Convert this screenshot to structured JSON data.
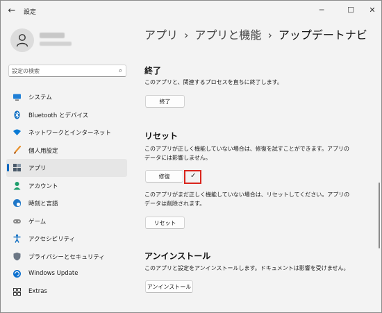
{
  "window": {
    "title": "設定",
    "back_icon": "arrow-left-icon",
    "controls": {
      "minimize": "─",
      "maximize": "☐",
      "close": "✕"
    }
  },
  "profile": {
    "avatar_icon": "person-icon"
  },
  "search": {
    "placeholder": "設定の検索",
    "icon": "search-icon"
  },
  "sidebar": {
    "items": [
      {
        "label": "システム",
        "icon": "monitor-icon",
        "color": "#0067c0"
      },
      {
        "label": "Bluetooth とデバイス",
        "icon": "bluetooth-icon",
        "color": "#0067c0"
      },
      {
        "label": "ネットワークとインターネット",
        "icon": "wifi-icon",
        "color": "#0a7ad4"
      },
      {
        "label": "個人用設定",
        "icon": "brush-icon",
        "color": "#e8912d"
      },
      {
        "label": "アプリ",
        "icon": "apps-icon",
        "color": "#4a5a6a",
        "active": true
      },
      {
        "label": "アカウント",
        "icon": "account-icon",
        "color": "#1e9e6c"
      },
      {
        "label": "時刻と言語",
        "icon": "globe-clock-icon",
        "color": "#1f77c8"
      },
      {
        "label": "ゲーム",
        "icon": "gamepad-icon",
        "color": "#7a7a7a"
      },
      {
        "label": "アクセシビリティ",
        "icon": "accessibility-icon",
        "color": "#1a74c4"
      },
      {
        "label": "プライバシーとセキュリティ",
        "icon": "shield-icon",
        "color": "#6c7785"
      },
      {
        "label": "Windows Update",
        "icon": "update-icon",
        "color": "#0a6fcf"
      },
      {
        "label": "Extras",
        "icon": "extras-icon",
        "color": "#333333"
      }
    ]
  },
  "breadcrumb": {
    "part1": "アプリ",
    "part2": "アプリと機能",
    "current": "アップデートナビ",
    "separator": "›"
  },
  "terminate": {
    "title": "終了",
    "description": "このアプリと、関連するプロセスを直ちに終了します。",
    "button": "終了"
  },
  "reset": {
    "title": "リセット",
    "repair_description": "このアプリが正しく機能していない場合は、修復を試すことができます。アプリのデータには影響しません。",
    "repair_button": "修復",
    "repair_done_icon": "checkmark-icon",
    "reset_description": "このアプリがまだ正しく機能していない場合は、リセットしてください。アプリのデータは削除されます。",
    "reset_button": "リセット"
  },
  "uninstall": {
    "title": "アンインストール",
    "description": "このアプリと設定をアンインストールします。ドキュメントは影響を受けません。",
    "button": "アンインストール"
  },
  "colors": {
    "accent": "#0067c0",
    "highlight_box": "#d9241c"
  }
}
